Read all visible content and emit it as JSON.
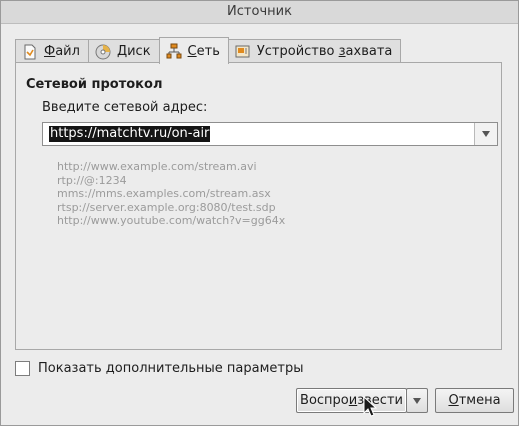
{
  "window": {
    "title": "Источник"
  },
  "tabs": [
    {
      "label_pre": "",
      "label_u": "Ф",
      "label_post": "айл",
      "icon": "file-icon"
    },
    {
      "label_pre": "",
      "label_u": "Д",
      "label_post": "иск",
      "icon": "disc-icon"
    },
    {
      "label_pre": "",
      "label_u": "С",
      "label_post": "еть",
      "icon": "network-icon"
    },
    {
      "label_pre": "Устройство ",
      "label_u": "з",
      "label_post": "ахвата",
      "icon": "capture-device-icon"
    }
  ],
  "active_tab": 2,
  "network": {
    "group_title": "Сетевой протокол",
    "address_label": "Введите сетевой адрес:",
    "address_value": "https://matchtv.ru/on-air",
    "examples": [
      "http://www.example.com/stream.avi",
      "rtp://@:1234",
      "mms://mms.examples.com/stream.asx",
      "rtsp://server.example.org:8080/test.sdp",
      "http://www.youtube.com/watch?v=gg64x"
    ]
  },
  "options": {
    "show_more_label": "Показать дополнительные параметры",
    "show_more_checked": false
  },
  "buttons": {
    "play_pre": "Воспро",
    "play_u": "и",
    "play_post": "звести",
    "cancel_pre": "",
    "cancel_u": "О",
    "cancel_post": "тмена"
  },
  "colors": {
    "selection": "#151515",
    "hint_text": "#9b9b9b"
  }
}
